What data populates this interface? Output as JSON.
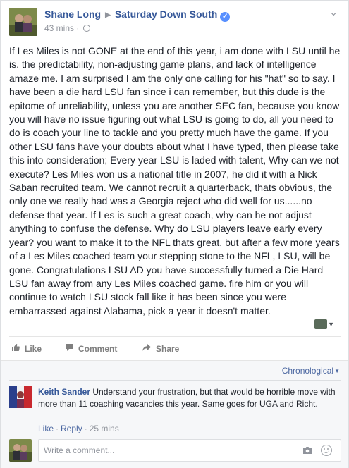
{
  "post": {
    "author": "Shane Long",
    "target": "Saturday Down South",
    "time": "43 mins",
    "separator": "·",
    "body": "If Les Miles is not GONE at the end of this year, i am done with LSU until he is. the predictability, non-adjusting game plans, and lack of intelligence amaze me. I am surprised I am the only one calling for his \"hat\" so to say. I have been a die hard LSU fan since i can remember, but this dude is the epitome of unreliability, unless you are another SEC fan, because you know you will have no issue figuring out what LSU is going to do, all you need to do is coach your line to tackle and you pretty much have the game. If you other LSU fans have your doubts about what I have typed, then please take this into consideration; Every year LSU is laded with talent, Why can we not execute? Les Miles won us a national title in 2007, he did it with a Nick Saban recruited team. We cannot recruit a quarterback, thats obvious, the only one we really had was a Georgia reject who did well for us......no defense that year. If Les is such a great coach, why can he not adjust anything to confuse the defense. Why do LSU players leave early every year? you want to make it to the NFL thats great, but after a few more years of a Les Miles coached team your stepping stone to the NFL, LSU, will be gone. Congratulations LSU AD you have successfully turned a Die Hard LSU fan away from any Les Miles coached game. fire him or you will continue to watch LSU stock fall like it has been since you were embarrassed against Alabama, pick a year it doesn't matter."
  },
  "actions": {
    "like": "Like",
    "comment": "Comment",
    "share": "Share"
  },
  "comments": {
    "order": "Chronological",
    "items": [
      {
        "author": "Keith Sander",
        "text": "Understand your frustration, but that would be horrible move with more than 11 coaching vacancies this year. Same goes for UGA and Richt.",
        "like": "Like",
        "reply": "Reply",
        "time": "25 mins"
      }
    ],
    "write_placeholder": "Write a comment..."
  },
  "colors": {
    "link": "#365899",
    "muted": "#90949c",
    "verified": "#5890ff"
  }
}
